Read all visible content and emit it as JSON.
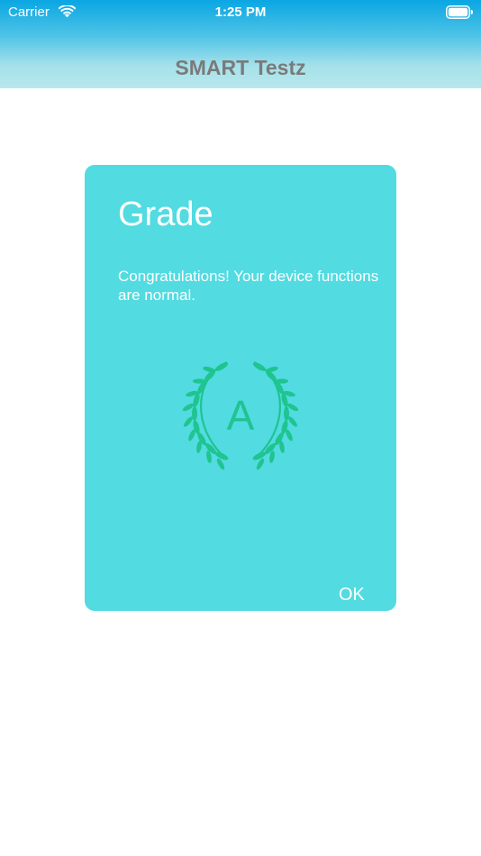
{
  "status_bar": {
    "carrier": "Carrier",
    "time": "1:25 PM",
    "wifi_icon": "wifi-icon",
    "battery_icon": "battery-icon"
  },
  "nav": {
    "title": "SMART Testz"
  },
  "dialog": {
    "title": "Grade",
    "message": "Congratulations! Your device functions are normal.",
    "grade": "A",
    "badge_icon": "laurel-wreath-icon",
    "ok_label": "OK"
  },
  "colors": {
    "header_gradient_top": "#0aa6e3",
    "header_gradient_bottom": "#b7e8ec",
    "nav_title": "#7a7a7a",
    "card_background": "#52dbe1",
    "wreath": "#1fc48f",
    "text_on_card": "#ffffff"
  }
}
